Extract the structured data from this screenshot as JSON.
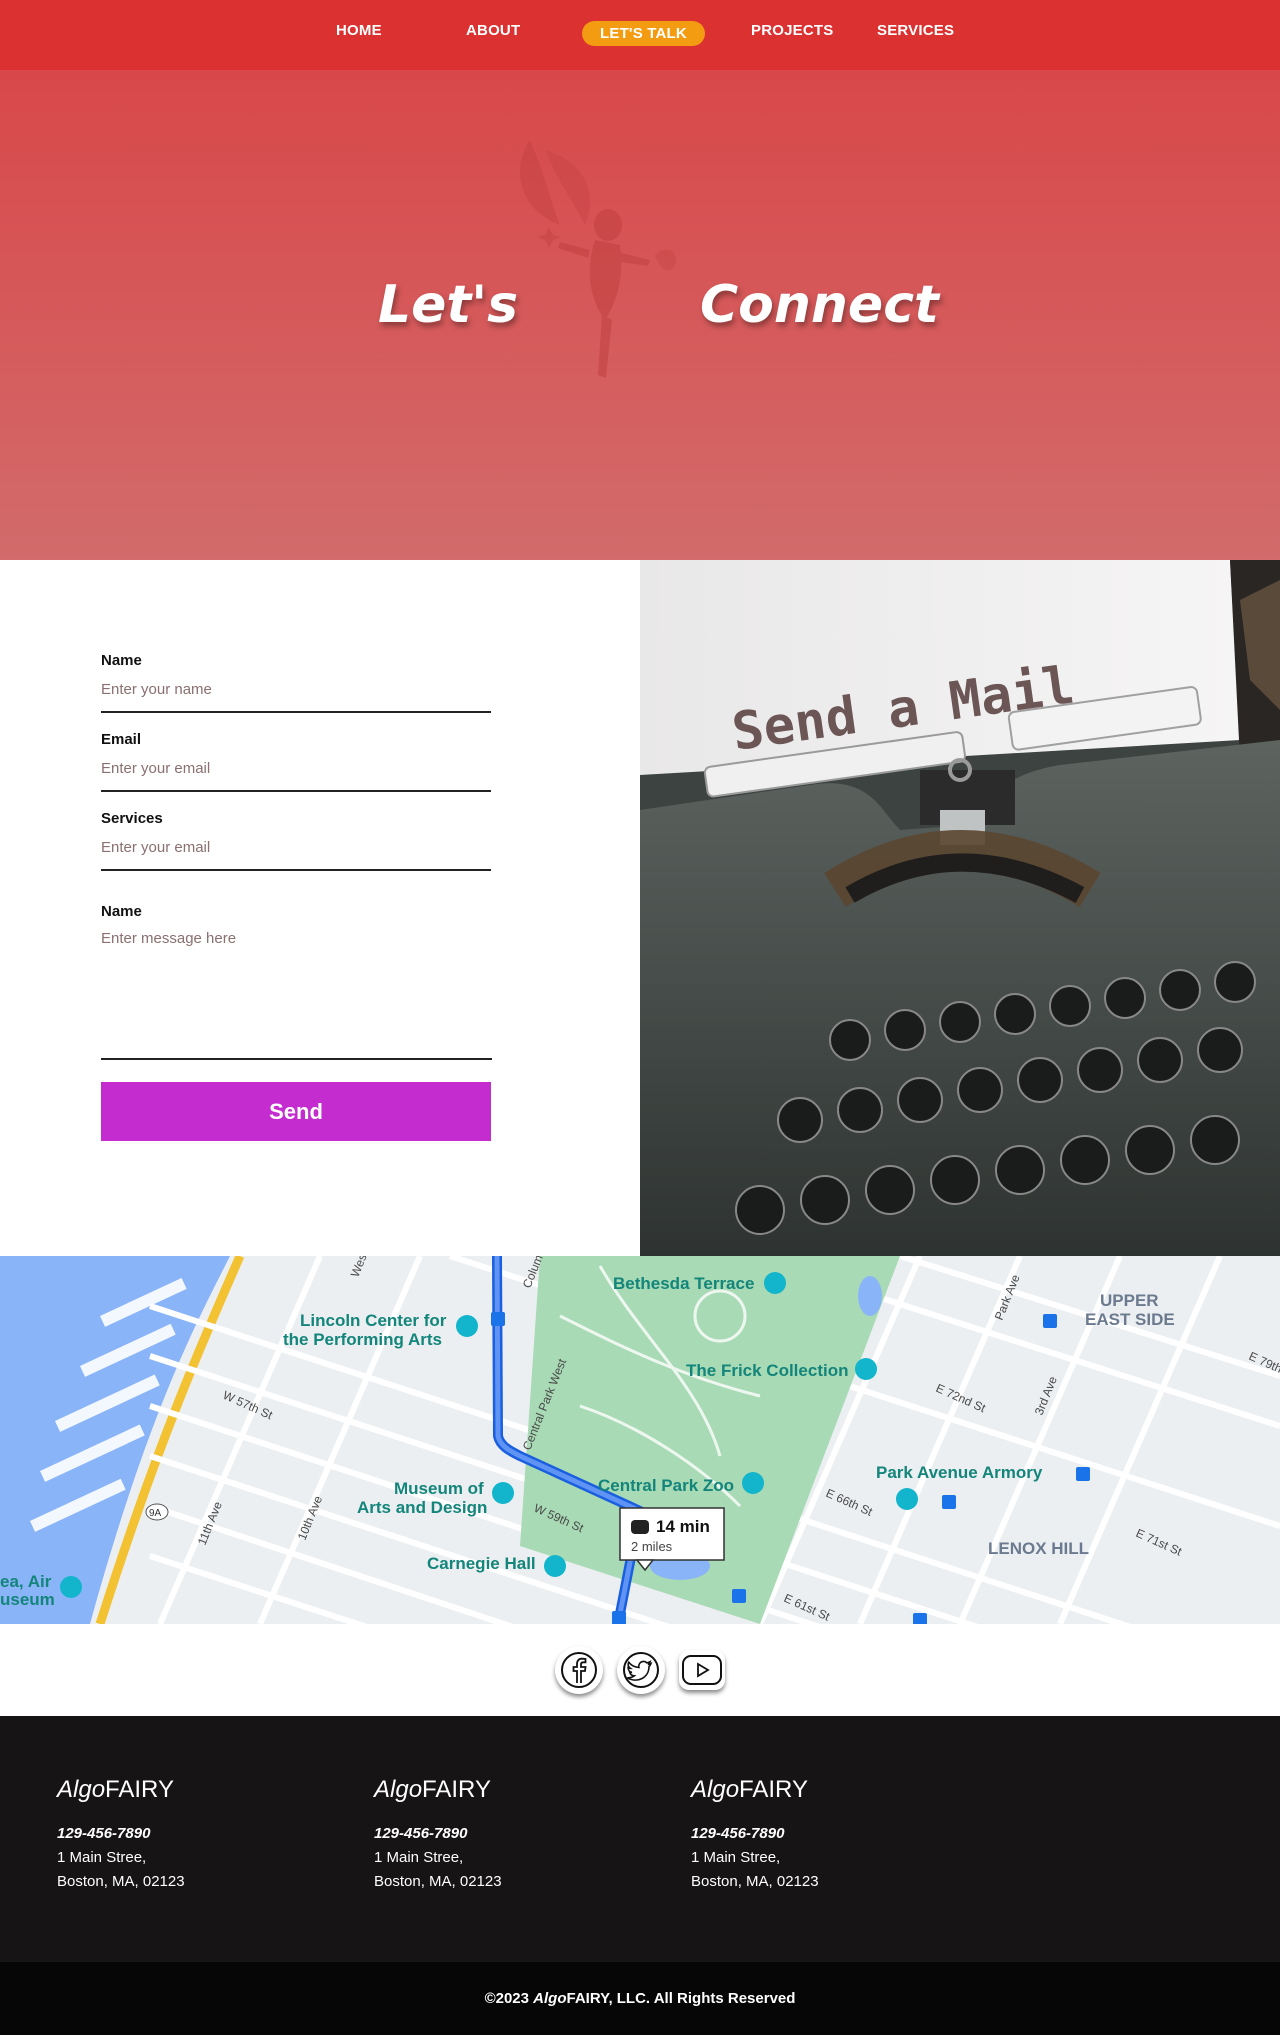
{
  "nav": {
    "items": [
      {
        "label": "HOME"
      },
      {
        "label": "ABOUT"
      },
      {
        "label": "LET'S TALK",
        "active": true
      },
      {
        "label": "PROJECTS"
      },
      {
        "label": "SERVICES"
      }
    ]
  },
  "hero": {
    "word1": "Let's",
    "word2": "Connect"
  },
  "form": {
    "name_label": "Name",
    "name_placeholder": "Enter your name",
    "email_label": "Email",
    "email_placeholder": "Enter your email",
    "services_label": "Services",
    "services_placeholder": "Enter your email",
    "message_label": "Name",
    "message_placeholder": "Enter message here",
    "send_label": "Send"
  },
  "image": {
    "paper_text": "Send a Mail"
  },
  "map": {
    "places": [
      "Bethesda Terrace",
      "Lincoln Center for",
      "the Performing Arts",
      "The Frick Collection",
      "UPPER",
      "EAST SIDE",
      "Central Park Zoo",
      "Park Avenue Armory",
      "Museum of",
      "Arts and Design",
      "Carnegie Hall",
      "LENOX HILL",
      "ea, Air",
      "useum"
    ],
    "streets": [
      "W 57th St",
      "11th Ave",
      "10th Ave",
      "Central Park West",
      "W 59th St",
      "E 72nd St",
      "E 66th St",
      "E 71st St",
      "E 61st St",
      "3rd Ave",
      "Park Ave",
      "E 79th",
      "Colum",
      "West"
    ],
    "route_time": "14 min",
    "route_distance": "2 miles",
    "highway": "9A"
  },
  "social": {
    "icons": [
      "facebook-icon",
      "twitter-icon",
      "youtube-icon"
    ]
  },
  "footer": {
    "columns": [
      {
        "brand_italic": "Algo",
        "brand_rest": "FAIRY",
        "phone": "129-456-7890",
        "address1": "1 Main Stree,",
        "address2": "Boston, MA, 02123"
      },
      {
        "brand_italic": "Algo",
        "brand_rest": "FAIRY",
        "phone": "129-456-7890",
        "address1": "1 Main Stree,",
        "address2": "Boston, MA, 02123"
      },
      {
        "brand_italic": "Algo",
        "brand_rest": "FAIRY",
        "phone": "129-456-7890",
        "address1": "1 Main Stree,",
        "address2": "Boston, MA, 02123"
      }
    ],
    "copyright_pre": "©2023 ",
    "copyright_italic": "Algo",
    "copyright_post": "FAIRY, LLC. All Rights Reserved"
  },
  "colors": {
    "nav_bg": "#dc3131",
    "active_pill": "#f39c12",
    "send_button": "#c42cd0",
    "footer_bg": "#161415"
  }
}
